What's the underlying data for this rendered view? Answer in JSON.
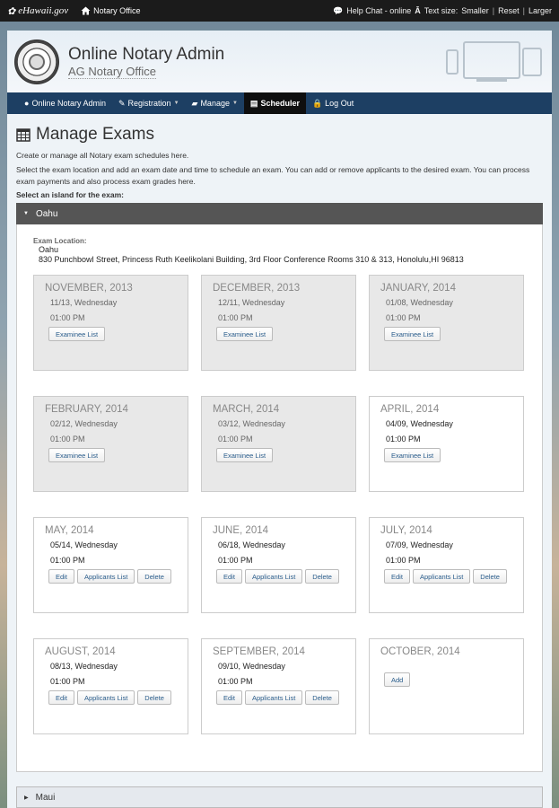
{
  "topbar": {
    "logo_text": "eHawaii.gov",
    "office_label": "Notary Office",
    "help_chat": "Help Chat - online",
    "text_size_label": "Text size:",
    "smaller": "Smaller",
    "reset": "Reset",
    "larger": "Larger"
  },
  "header": {
    "title": "Online Notary Admin",
    "subtitle": "AG Notary Office"
  },
  "nav": {
    "items": [
      {
        "label": "Online Notary Admin"
      },
      {
        "label": "Registration"
      },
      {
        "label": "Manage"
      },
      {
        "label": "Scheduler"
      },
      {
        "label": "Log Out"
      }
    ]
  },
  "page": {
    "title": "Manage Exams",
    "intro": "Create or manage all Notary exam schedules here.",
    "description": "Select the exam location and add an exam date and time to schedule an exam. You can add or remove applicants to the desired exam. You can process exam payments and also process exam grades here.",
    "select_label": "Select an island for the exam:"
  },
  "oahu": {
    "name": "Oahu",
    "location_label": "Exam Location:",
    "location_island": "Oahu",
    "location_address": "830 Punchbowl Street, Princess Ruth Keelikolani Building, 3rd Floor Conference Rooms 310 & 313, Honolulu,HI 96813"
  },
  "cards": [
    {
      "month": "NOVEMBER, 2013",
      "date": "11/13, Wednesday",
      "time": "01:00 PM",
      "buttons": [
        "Examinee List"
      ],
      "past": true
    },
    {
      "month": "DECEMBER, 2013",
      "date": "12/11, Wednesday",
      "time": "01:00 PM",
      "buttons": [
        "Examinee List"
      ],
      "past": true
    },
    {
      "month": "JANUARY, 2014",
      "date": "01/08, Wednesday",
      "time": "01:00 PM",
      "buttons": [
        "Examinee List"
      ],
      "past": true
    },
    {
      "month": "FEBRUARY, 2014",
      "date": "02/12, Wednesday",
      "time": "01:00 PM",
      "buttons": [
        "Examinee List"
      ],
      "past": true
    },
    {
      "month": "MARCH, 2014",
      "date": "03/12, Wednesday",
      "time": "01:00 PM",
      "buttons": [
        "Examinee List"
      ],
      "past": true
    },
    {
      "month": "APRIL, 2014",
      "date": "04/09, Wednesday",
      "time": "01:00 PM",
      "buttons": [
        "Examinee List"
      ],
      "past": false
    },
    {
      "month": "MAY, 2014",
      "date": "05/14, Wednesday",
      "time": "01:00 PM",
      "buttons": [
        "Edit",
        "Applicants List",
        "Delete"
      ],
      "past": false
    },
    {
      "month": "JUNE, 2014",
      "date": "06/18, Wednesday",
      "time": "01:00 PM",
      "buttons": [
        "Edit",
        "Applicants List",
        "Delete"
      ],
      "past": false
    },
    {
      "month": "JULY, 2014",
      "date": "07/09, Wednesday",
      "time": "01:00 PM",
      "buttons": [
        "Edit",
        "Applicants List",
        "Delete"
      ],
      "past": false
    },
    {
      "month": "AUGUST, 2014",
      "date": "08/13, Wednesday",
      "time": "01:00 PM",
      "buttons": [
        "Edit",
        "Applicants List",
        "Delete"
      ],
      "past": false
    },
    {
      "month": "SEPTEMBER, 2014",
      "date": "09/10, Wednesday",
      "time": "01:00 PM",
      "buttons": [
        "Edit",
        "Applicants List",
        "Delete"
      ],
      "past": false
    },
    {
      "month": "OCTOBER, 2014",
      "date": "",
      "time": "",
      "buttons": [
        "Add"
      ],
      "past": false
    }
  ],
  "maui": {
    "name": "Maui"
  }
}
